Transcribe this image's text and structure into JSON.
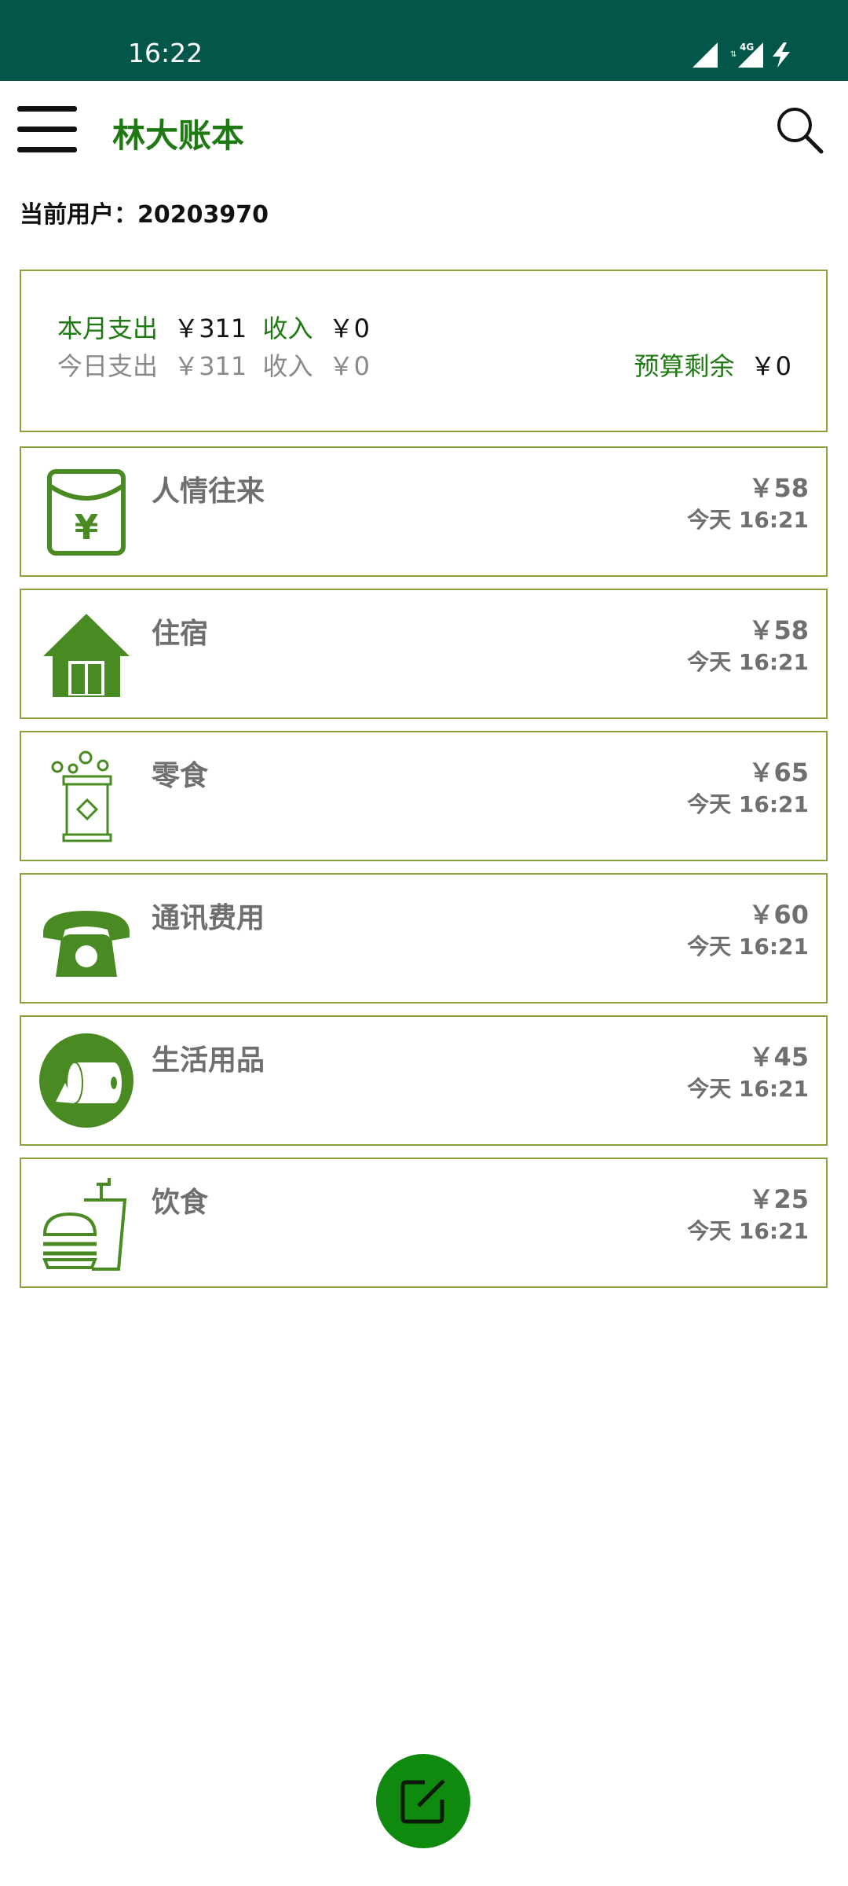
{
  "status": {
    "time": "16:22",
    "network": "4G"
  },
  "app": {
    "title": "林大账本"
  },
  "user": {
    "label": "当前用户：",
    "id": "20203970"
  },
  "summary": {
    "month_expense_label": "本月支出",
    "month_expense": "￥311",
    "month_income_label": "收入",
    "month_income": "￥0",
    "day_expense_label": "今日支出",
    "day_expense": "￥311",
    "day_income_label": "收入",
    "day_income": "￥0",
    "budget_label": "预算剩余",
    "budget_value": "￥0"
  },
  "records": [
    {
      "category": "人情往来",
      "amount": "￥58",
      "time": "今天 16:21",
      "icon": "red-envelope-icon"
    },
    {
      "category": "住宿",
      "amount": "￥58",
      "time": "今天 16:21",
      "icon": "house-icon"
    },
    {
      "category": "零食",
      "amount": "￥65",
      "time": "今天 16:21",
      "icon": "snack-jar-icon"
    },
    {
      "category": "通讯费用",
      "amount": "￥60",
      "time": "今天 16:21",
      "icon": "telephone-icon"
    },
    {
      "category": "生活用品",
      "amount": "￥45",
      "time": "今天 16:21",
      "icon": "toilet-paper-icon"
    },
    {
      "category": "饮食",
      "amount": "￥25",
      "time": "今天 16:21",
      "icon": "burger-drink-icon"
    }
  ],
  "colors": {
    "status_bar": "#03574a",
    "accent": "#1f7a14",
    "border": "#8aa23a",
    "fab": "#0f8a0f",
    "icon": "#4a8a22"
  }
}
